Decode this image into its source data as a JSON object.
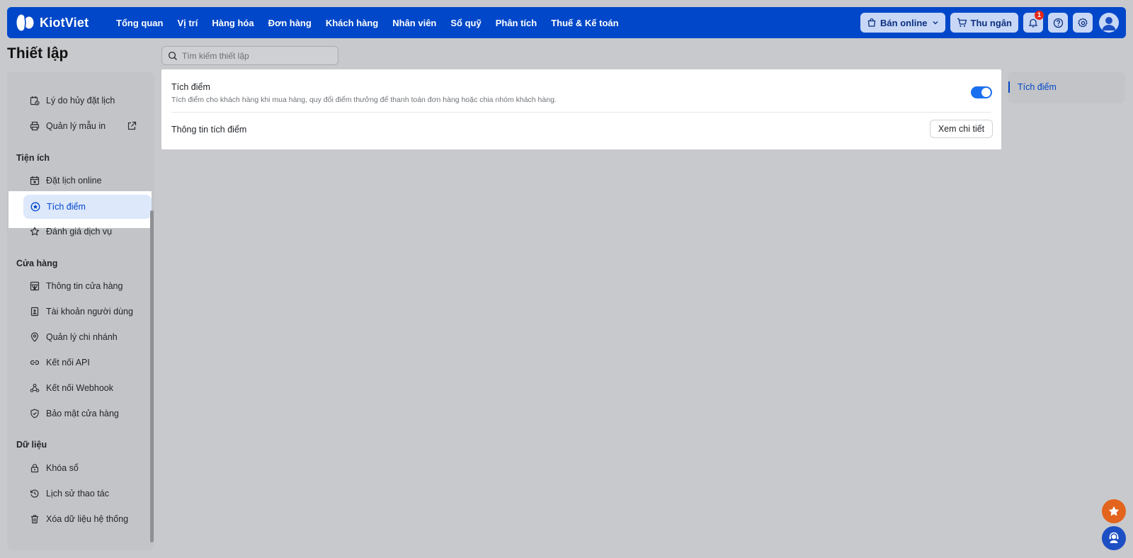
{
  "brand": {
    "name": "KiotViet"
  },
  "nav": {
    "items": [
      {
        "label": "Tổng quan"
      },
      {
        "label": "Vị trí"
      },
      {
        "label": "Hàng hóa"
      },
      {
        "label": "Đơn hàng"
      },
      {
        "label": "Khách hàng"
      },
      {
        "label": "Nhân viên"
      },
      {
        "label": "Sổ quỹ"
      },
      {
        "label": "Phân tích"
      },
      {
        "label": "Thuế & Kế toán"
      }
    ]
  },
  "actions": {
    "ban_online": "Bán online",
    "thu_ngan": "Thu ngân",
    "notification_count": "1"
  },
  "page": {
    "title": "Thiết lập",
    "search_placeholder": "Tìm kiếm thiết lập"
  },
  "sidebar": {
    "items_top": [
      {
        "label": "Lý do hủy đặt lịch",
        "icon": "calendar-cancel-icon"
      },
      {
        "label": "Quản lý mẫu in",
        "icon": "printer-icon",
        "external": "external-link-icon"
      }
    ],
    "sections": {
      "tien_ich": {
        "title": "Tiện ích",
        "items": [
          {
            "label": "Đặt lịch online",
            "icon": "calendar-icon"
          },
          {
            "label": "Tích điểm",
            "icon": "star-circle-icon",
            "active": true
          },
          {
            "label": "Đánh giá dịch vụ",
            "icon": "star-icon"
          }
        ]
      },
      "cua_hang": {
        "title": "Cửa hàng",
        "items": [
          {
            "label": "Thông tin cửa hàng",
            "icon": "store-icon"
          },
          {
            "label": "Tài khoản người dùng",
            "icon": "user-file-icon"
          },
          {
            "label": "Quản lý chi nhánh",
            "icon": "location-pin-icon"
          },
          {
            "label": "Kết nối API",
            "icon": "link-icon"
          },
          {
            "label": "Kết nối Webhook",
            "icon": "webhook-icon"
          },
          {
            "label": "Bảo mật cửa hàng",
            "icon": "shield-icon"
          }
        ]
      },
      "du_lieu": {
        "title": "Dữ liệu",
        "items": [
          {
            "label": "Khóa sổ",
            "icon": "lock-icon"
          },
          {
            "label": "Lịch sử thao tác",
            "icon": "history-icon"
          },
          {
            "label": "Xóa dữ liệu hệ thống",
            "icon": "trash-icon"
          }
        ]
      }
    }
  },
  "main": {
    "setting_title": "Tích điểm",
    "setting_desc": "Tích điểm cho khách hàng khi mua hàng, quy đổi điểm thưởng để thanh toán đơn hàng hoặc chia nhóm khách hàng.",
    "toggle_on": true,
    "info_label": "Thông tin tích điểm",
    "detail_button": "Xem chi tiết"
  },
  "anchor": {
    "label": "Tích điểm"
  },
  "colors": {
    "primary": "#0047c9",
    "toggle": "#1a6ff0",
    "badge": "#e5281a",
    "fab_star": "#e2641d",
    "fab_support": "#1d4fc4"
  }
}
